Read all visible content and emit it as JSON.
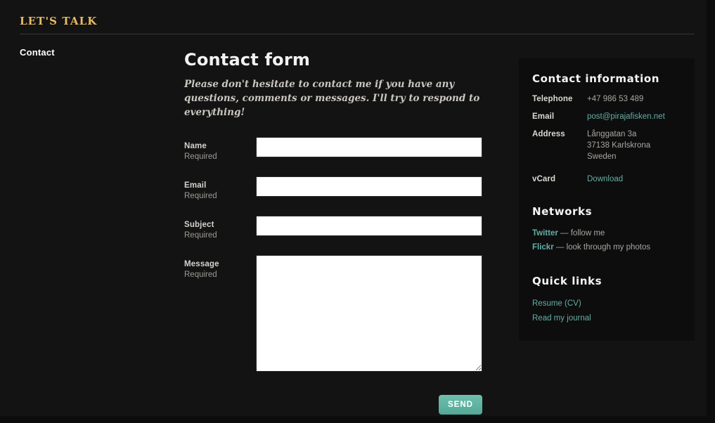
{
  "site": {
    "title": "LET'S TALK"
  },
  "nav": {
    "items": [
      {
        "label": "Contact"
      }
    ]
  },
  "form": {
    "heading": "Contact form",
    "intro": "Please don't hesitate to contact me if you have any questions, comments or messages. I'll try to respond to everything!",
    "fields": [
      {
        "label": "Name",
        "requirement": "Required",
        "value": "",
        "placeholder": ""
      },
      {
        "label": "Email",
        "requirement": "Required",
        "value": "",
        "placeholder": ""
      },
      {
        "label": "Subject",
        "requirement": "Required",
        "value": "",
        "placeholder": ""
      },
      {
        "label": "Message",
        "requirement": "Required",
        "value": "",
        "placeholder": ""
      }
    ],
    "submit_label": "SEND"
  },
  "aside": {
    "contact_heading": "Contact information",
    "rows": [
      {
        "label": "Telephone",
        "value": "+47 986 53 489",
        "is_link": false
      },
      {
        "label": "Email",
        "value": "post@pirajafisken.net",
        "is_link": true
      },
      {
        "label": "Address",
        "line1": "Långgatan 3a",
        "line2": "37138 Karlskrona",
        "line3": "Sweden",
        "is_link": false
      },
      {
        "label": "vCard",
        "value": "Download",
        "is_link": true
      }
    ],
    "networks_heading": "Networks",
    "networks": [
      {
        "name": "Twitter",
        "dash": " — ",
        "description": "follow me"
      },
      {
        "name": "Flickr",
        "dash": " — ",
        "description": "look through my photos"
      }
    ],
    "quick_links_heading": "Quick links",
    "quick_links": [
      {
        "label": "Resume (CV)"
      },
      {
        "label": "Read my journal"
      }
    ]
  },
  "colors": {
    "accent_gold": "#e9ba64",
    "accent_teal": "#64ada5",
    "button_teal": "#53a897",
    "page_bg": "#131313",
    "panel_bg": "#0d0d0d"
  }
}
